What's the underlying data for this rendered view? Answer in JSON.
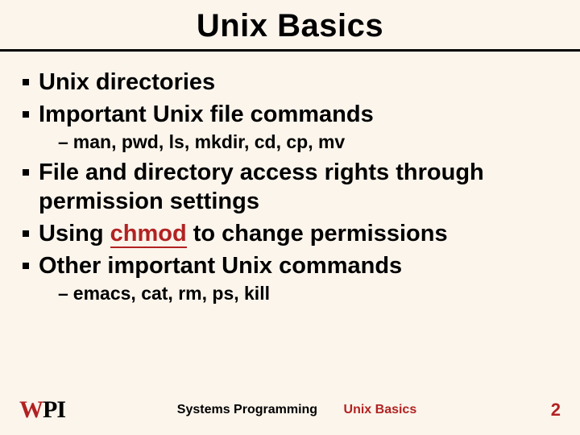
{
  "title": "Unix Basics",
  "bullets": {
    "b1": "Unix directories",
    "b2": "Important Unix file commands",
    "sub1": "man, pwd, ls, mkdir, cd, cp, mv",
    "b3": "File and directory access rights through permission settings",
    "b4_pre": "Using ",
    "b4_cmd": "chmod",
    "b4_post": " to change permissions",
    "b5": "Other important Unix commands",
    "sub2": "emacs, cat, rm, ps, kill"
  },
  "footer": {
    "left_w": "W",
    "left_p": "P",
    "left_i": "I",
    "center1": "Systems Programming",
    "center2": "Unix Basics",
    "page": "2"
  }
}
